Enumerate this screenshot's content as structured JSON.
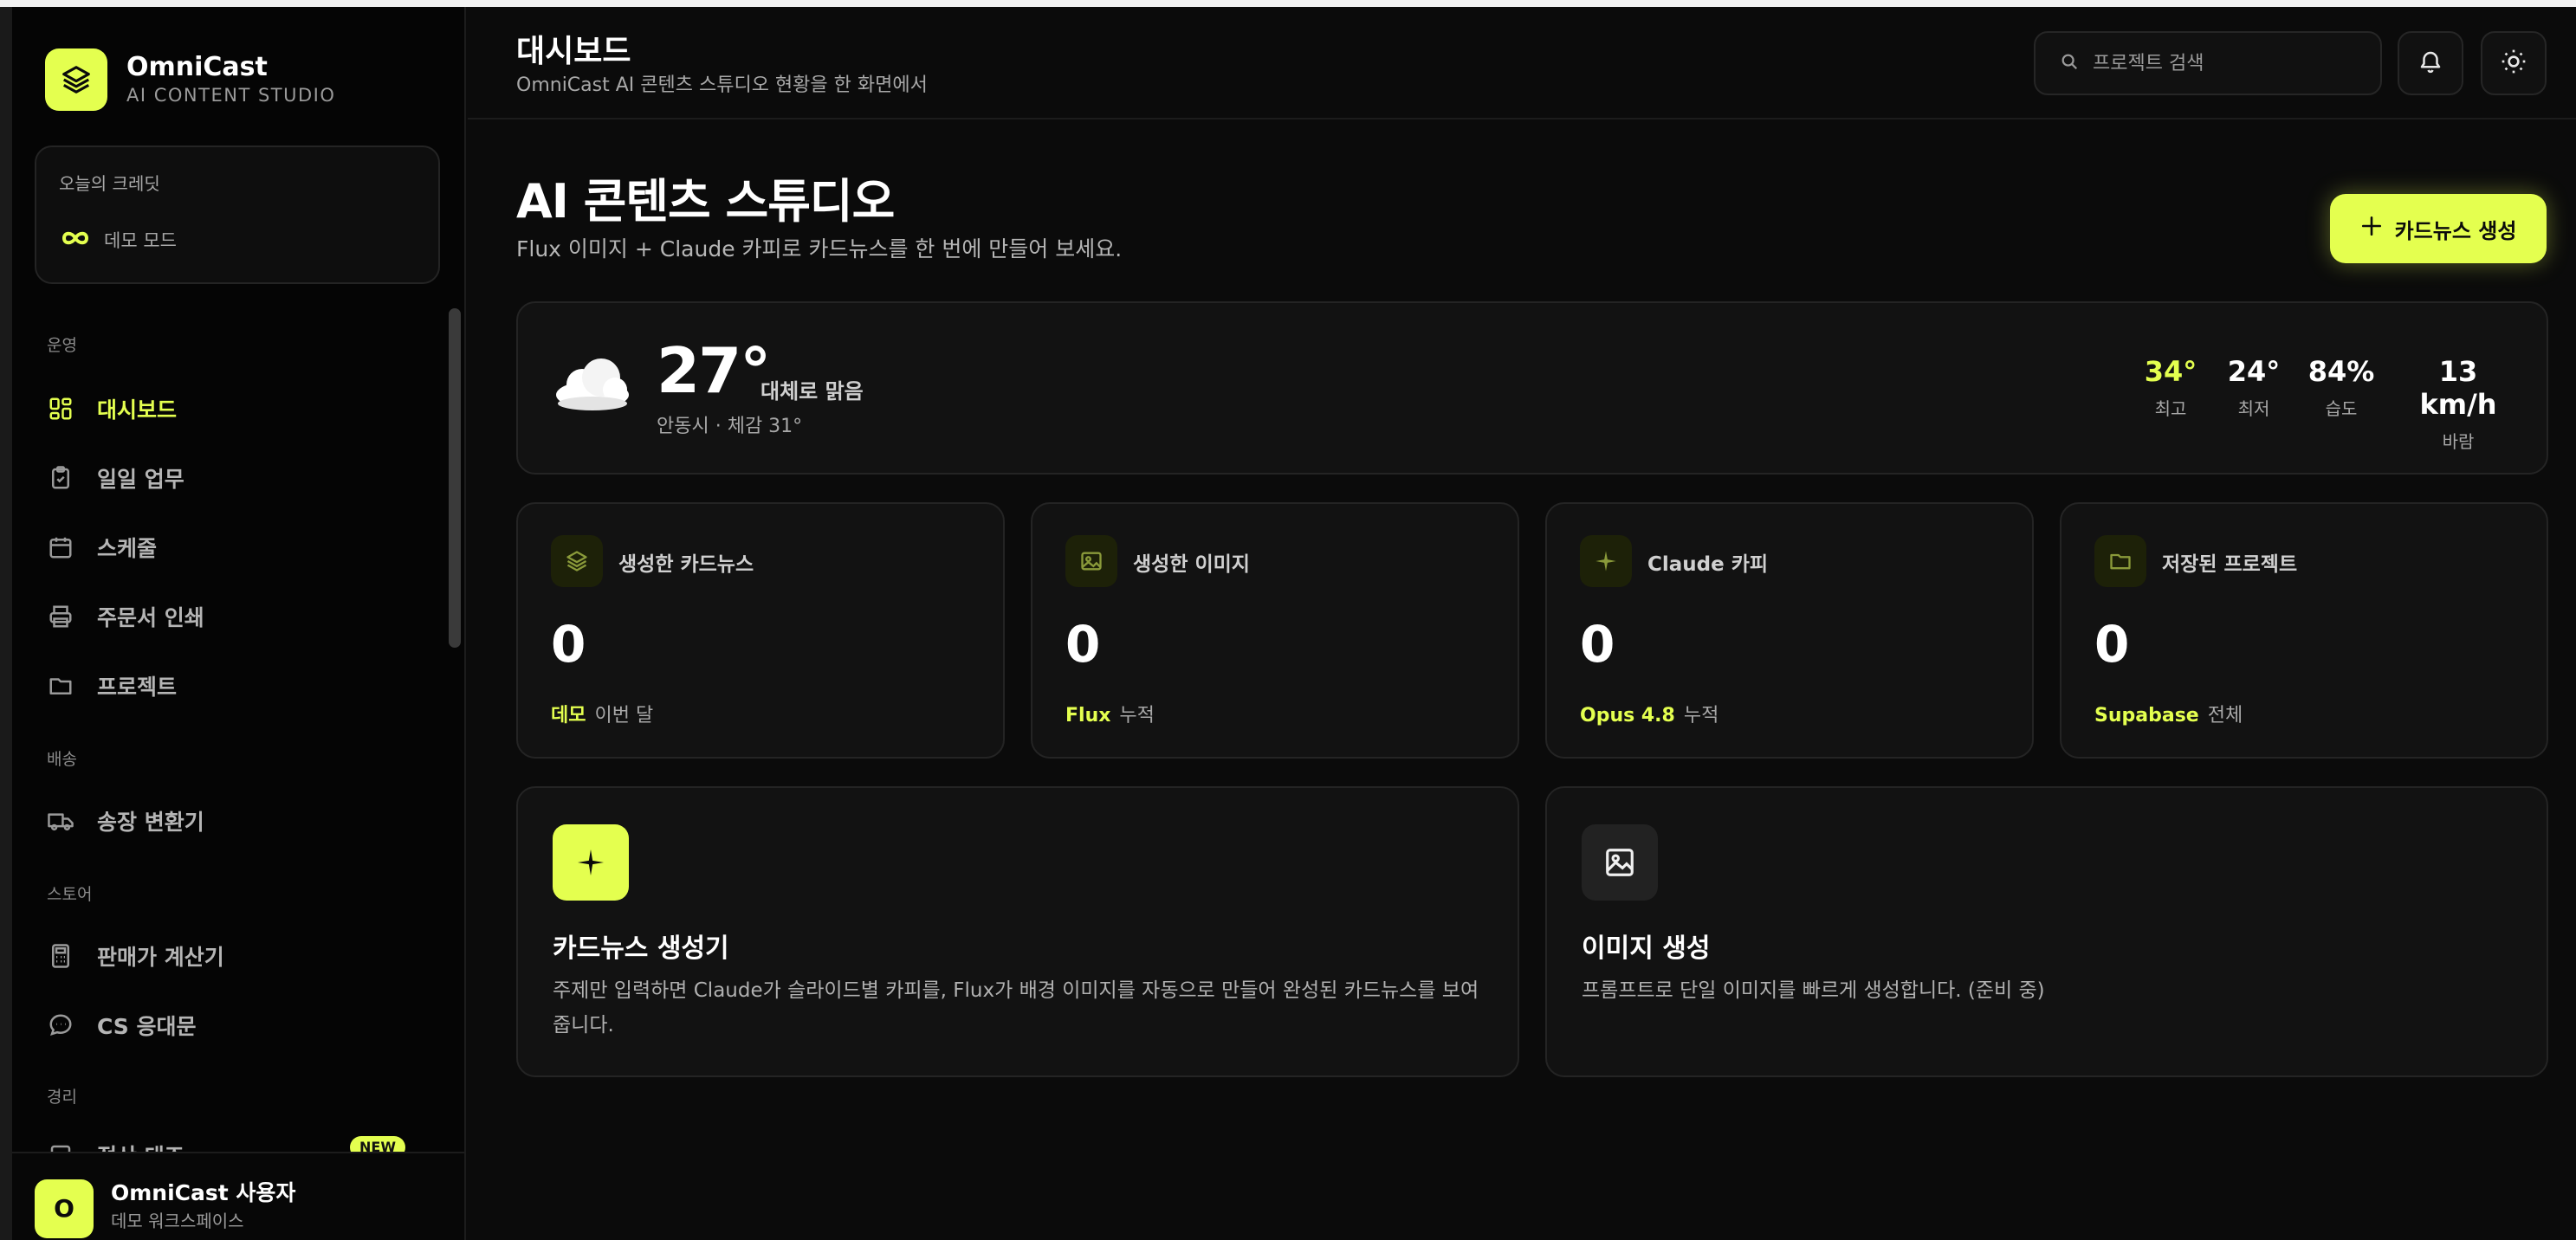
{
  "app": {
    "name": "OmniCast",
    "subtitle": "AI CONTENT STUDIO"
  },
  "credit": {
    "title": "오늘의 크레딧",
    "mode": "데모 모드"
  },
  "sidebar": {
    "sections": [
      {
        "label": "운영"
      },
      {
        "label": "배송"
      },
      {
        "label": "스토어"
      },
      {
        "label": "경리"
      }
    ],
    "items": [
      {
        "label": "대시보드",
        "icon": "dashboard-icon",
        "active": true
      },
      {
        "label": "일일 업무",
        "icon": "clipboard-icon"
      },
      {
        "label": "스케줄",
        "icon": "calendar-icon"
      },
      {
        "label": "주문서 인쇄",
        "icon": "printer-icon"
      },
      {
        "label": "프로젝트",
        "icon": "folder-icon"
      },
      {
        "label": "송장 변환기",
        "icon": "truck-icon"
      },
      {
        "label": "판매가 계산기",
        "icon": "calculator-icon"
      },
      {
        "label": "CS 응대문",
        "icon": "chat-icon"
      },
      {
        "label": "정산 대조",
        "icon": "document-icon"
      }
    ],
    "new_badge": "NEW"
  },
  "user": {
    "initial": "O",
    "name": "OmniCast 사용자",
    "workspace": "데모 워크스페이스"
  },
  "header": {
    "title": "대시보드",
    "subtitle": "OmniCast AI 콘텐츠 스튜디오 현황을 한 화면에서",
    "search_placeholder": "프로젝트 검색"
  },
  "hero": {
    "title": "AI 콘텐츠 스튜디오",
    "subtitle": "Flux 이미지 + Claude 카피로 카드뉴스를 한 번에 만들어 보세요.",
    "cta_label": "카드뉴스 생성"
  },
  "weather": {
    "temp": "27°",
    "condition": "대체로 맑음",
    "location": "안동시 · 체감 31°",
    "stats": [
      {
        "value": "34°",
        "label": "최고",
        "highlight": true
      },
      {
        "value": "24°",
        "label": "최저"
      },
      {
        "value": "84%",
        "label": "습도"
      },
      {
        "value": "13 km/h",
        "label": "바람"
      }
    ]
  },
  "stats": [
    {
      "title": "생성한 카드뉴스",
      "value": "0",
      "tag": "데모",
      "note": "이번 달",
      "icon": "layers-icon"
    },
    {
      "title": "생성한 이미지",
      "value": "0",
      "tag": "Flux",
      "note": "누적",
      "icon": "image-icon"
    },
    {
      "title": "Claude 카피",
      "value": "0",
      "tag": "Opus 4.8",
      "note": "누적",
      "icon": "sparkle-icon"
    },
    {
      "title": "저장된 프로젝트",
      "value": "0",
      "tag": "Supabase",
      "note": "전체",
      "icon": "folder-icon"
    }
  ],
  "features": [
    {
      "title": "카드뉴스 생성기",
      "desc": "주제만 입력하면 Claude가 슬라이드별 카피를, Flux가 배경 이미지를 자동으로 만들어 완성된 카드뉴스를 보여줍니다."
    },
    {
      "title": "이미지 생성",
      "desc": "프롬프트로 단일 이미지를 빠르게 생성합니다. (준비 중)"
    }
  ],
  "colors": {
    "accent": "#e4ff4f",
    "background": "#0b0b0b",
    "card": "#121212"
  }
}
